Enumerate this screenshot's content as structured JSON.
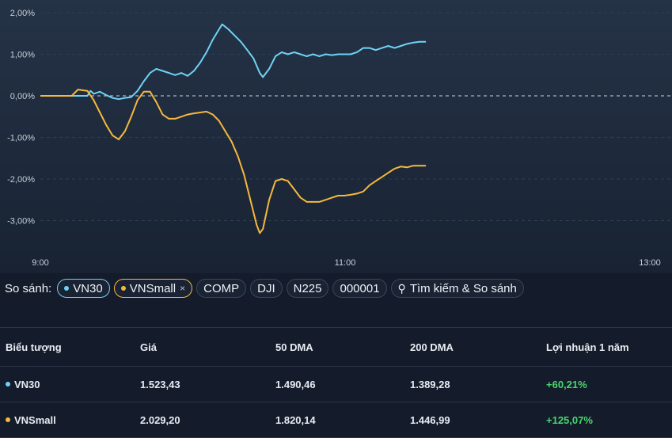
{
  "chart_data": {
    "type": "line",
    "x_ticks": [
      "9:00",
      "11:00",
      "13:00"
    ],
    "y_ticks": [
      "2,00%",
      "1,00%",
      "0,00%",
      "-1,00%",
      "-2,00%",
      "-3,00%"
    ],
    "ylim": [
      -3.6,
      2.2
    ],
    "grid": true,
    "series": [
      {
        "name": "VN30",
        "color": "#6fd3f5",
        "points": [
          [
            0,
            0
          ],
          [
            10,
            0
          ],
          [
            15,
            0
          ],
          [
            16,
            0.12
          ],
          [
            17,
            0.05
          ],
          [
            19,
            0.1
          ],
          [
            21,
            0.02
          ],
          [
            23,
            -0.05
          ],
          [
            25,
            -0.08
          ],
          [
            27,
            -0.05
          ],
          [
            29,
            -0.03
          ],
          [
            31,
            0.12
          ],
          [
            33,
            0.35
          ],
          [
            35,
            0.55
          ],
          [
            37,
            0.65
          ],
          [
            39,
            0.6
          ],
          [
            41,
            0.55
          ],
          [
            43,
            0.5
          ],
          [
            45,
            0.55
          ],
          [
            47,
            0.48
          ],
          [
            49,
            0.6
          ],
          [
            51,
            0.8
          ],
          [
            53,
            1.05
          ],
          [
            55,
            1.35
          ],
          [
            57,
            1.6
          ],
          [
            58,
            1.72
          ],
          [
            60,
            1.6
          ],
          [
            62,
            1.45
          ],
          [
            64,
            1.3
          ],
          [
            66,
            1.1
          ],
          [
            68,
            0.9
          ],
          [
            70,
            0.55
          ],
          [
            71,
            0.45
          ],
          [
            73,
            0.65
          ],
          [
            75,
            0.95
          ],
          [
            77,
            1.05
          ],
          [
            79,
            1.0
          ],
          [
            81,
            1.05
          ],
          [
            83,
            1.0
          ],
          [
            85,
            0.95
          ],
          [
            87,
            1.0
          ],
          [
            89,
            0.95
          ],
          [
            91,
            1.0
          ],
          [
            93,
            0.98
          ],
          [
            95,
            1.0
          ],
          [
            97,
            1.0
          ],
          [
            99,
            1.0
          ],
          [
            101,
            1.05
          ],
          [
            103,
            1.15
          ],
          [
            105,
            1.15
          ],
          [
            107,
            1.1
          ],
          [
            109,
            1.15
          ],
          [
            111,
            1.2
          ],
          [
            113,
            1.15
          ],
          [
            115,
            1.2
          ],
          [
            117,
            1.25
          ],
          [
            119,
            1.28
          ],
          [
            121,
            1.3
          ],
          [
            123,
            1.3
          ]
        ]
      },
      {
        "name": "VNSmall",
        "color": "#f5b93c",
        "points": [
          [
            0,
            0
          ],
          [
            10,
            0
          ],
          [
            12,
            0.15
          ],
          [
            15,
            0.12
          ],
          [
            17,
            -0.1
          ],
          [
            19,
            -0.4
          ],
          [
            21,
            -0.7
          ],
          [
            23,
            -0.95
          ],
          [
            25,
            -1.05
          ],
          [
            27,
            -0.85
          ],
          [
            29,
            -0.5
          ],
          [
            31,
            -0.1
          ],
          [
            33,
            0.1
          ],
          [
            35,
            0.1
          ],
          [
            37,
            -0.15
          ],
          [
            39,
            -0.45
          ],
          [
            41,
            -0.55
          ],
          [
            43,
            -0.55
          ],
          [
            45,
            -0.5
          ],
          [
            47,
            -0.45
          ],
          [
            49,
            -0.42
          ],
          [
            51,
            -0.4
          ],
          [
            53,
            -0.38
          ],
          [
            55,
            -0.45
          ],
          [
            57,
            -0.6
          ],
          [
            59,
            -0.85
          ],
          [
            61,
            -1.1
          ],
          [
            63,
            -1.45
          ],
          [
            65,
            -1.9
          ],
          [
            67,
            -2.5
          ],
          [
            69,
            -3.1
          ],
          [
            70,
            -3.3
          ],
          [
            71,
            -3.2
          ],
          [
            73,
            -2.5
          ],
          [
            75,
            -2.05
          ],
          [
            77,
            -2.0
          ],
          [
            79,
            -2.05
          ],
          [
            81,
            -2.25
          ],
          [
            83,
            -2.45
          ],
          [
            85,
            -2.55
          ],
          [
            87,
            -2.55
          ],
          [
            89,
            -2.55
          ],
          [
            91,
            -2.5
          ],
          [
            93,
            -2.45
          ],
          [
            95,
            -2.4
          ],
          [
            97,
            -2.4
          ],
          [
            99,
            -2.38
          ],
          [
            101,
            -2.35
          ],
          [
            103,
            -2.3
          ],
          [
            105,
            -2.15
          ],
          [
            107,
            -2.05
          ],
          [
            109,
            -1.95
          ],
          [
            111,
            -1.85
          ],
          [
            113,
            -1.75
          ],
          [
            115,
            -1.7
          ],
          [
            117,
            -1.72
          ],
          [
            119,
            -1.68
          ],
          [
            121,
            -1.68
          ],
          [
            123,
            -1.68
          ]
        ]
      }
    ]
  },
  "compare": {
    "label": "So sánh:",
    "chips": [
      {
        "id": "vn30",
        "label": "VN30",
        "dot_color": "#6fd3f5",
        "active": true,
        "removable": false
      },
      {
        "id": "vnsmall",
        "label": "VNSmall",
        "dot_color": "#f5b93c",
        "active": true,
        "removable": true
      },
      {
        "id": "comp",
        "label": "COMP"
      },
      {
        "id": "dji",
        "label": "DJI"
      },
      {
        "id": "n225",
        "label": "N225"
      },
      {
        "id": "sse",
        "label": "000001"
      }
    ],
    "search_label": "Tìm kiếm & So sánh",
    "close_glyph": "×",
    "search_glyph": "⚲"
  },
  "table": {
    "columns": [
      "Biểu tượng",
      "Giá",
      "50 DMA",
      "200 DMA",
      "Lợi nhuận 1 năm"
    ],
    "rows": [
      {
        "symbol": "VN30",
        "dot_color": "#6fd3f5",
        "price": "1.523,43",
        "dma50": "1.490,46",
        "dma200": "1.389,28",
        "return_1y": "+60,21%"
      },
      {
        "symbol": "VNSmall",
        "dot_color": "#f5b93c",
        "price": "2.029,20",
        "dma50": "1.820,14",
        "dma200": "1.446,99",
        "return_1y": "+125,07%"
      }
    ]
  },
  "colors": {
    "gain": "#4ad66d",
    "grid": "#2f3d52",
    "zero_line": "#aab3c0"
  }
}
